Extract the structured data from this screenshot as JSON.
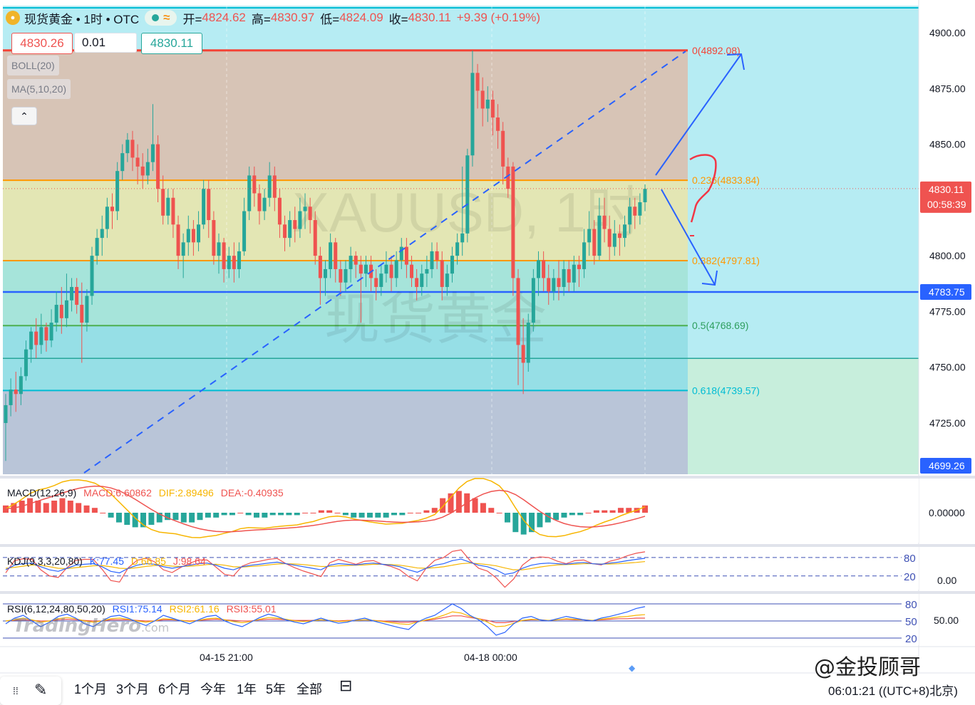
{
  "header": {
    "symbol_name": "现货黄金 • 1时 • OTC",
    "open_label": "开=",
    "open": "4824.62",
    "high_label": "高=",
    "high": "4830.97",
    "low_label": "低=",
    "low": "4824.09",
    "close_label": "收=",
    "close": "4830.11",
    "change": "+9.39 (+0.19%)"
  },
  "quote": {
    "bid": "4830.26",
    "spread": "0.01",
    "ask": "4830.11"
  },
  "indicators": {
    "boll": "BOLL(20)",
    "ma": "MA(5,10,20)"
  },
  "watermark": {
    "line1": "XAUUSD, 1时",
    "line2": "现货黄金"
  },
  "price_axis": {
    "ticks": [
      "4900.00",
      "4875.00",
      "4850.00",
      "4800.00",
      "4775.00",
      "4750.00",
      "4725.00"
    ],
    "current_price": "4830.11",
    "countdown": "00:58:39",
    "line_label": "4783.75",
    "low_label": "4699.26"
  },
  "fib": {
    "l0": "0(4892.08)",
    "l236": "0.236(4833.84)",
    "l382": "0.382(4797.81)",
    "l5": "0.5(4768.69)",
    "l618": "0.618(4739.57)"
  },
  "macd": {
    "title": "MACD(12,26,9)",
    "macd": "MACD:6.60862",
    "dif": "DIF:2.89496",
    "dea": "DEA:-0.40935",
    "axis": "0.00000"
  },
  "kdj": {
    "title": "KDJ(9,3,3,20,80)",
    "k": "K:77.45",
    "d": "D:66.85",
    "j": "J:98.64",
    "upper": "80",
    "lower": "20",
    "axis": "0.00"
  },
  "rsi": {
    "title": "RSI(6,12,24,80,50,20)",
    "rsi1": "RSI1:75.14",
    "rsi2": "RSI2:61.16",
    "rsi3": "RSI3:55.01",
    "l80": "80",
    "l50": "50",
    "l20": "20",
    "axis": "50.00"
  },
  "time_axis": [
    "04-15 21:00",
    "04-18 00:00"
  ],
  "timeframes": [
    "1个月",
    "3个月",
    "6个月",
    "今年",
    "1年",
    "5年",
    "全部"
  ],
  "clock": "06:01:21 ((UTC+8)北京)",
  "brand": "@金投顾哥",
  "logo": {
    "main": "TradingHero",
    "suffix": ".com"
  },
  "colors": {
    "up": "#26a69a",
    "down": "#ef5350",
    "fib0": "#f44336",
    "fib236": "#ff9800",
    "fib382": "#ff9800",
    "fib5": "#4caf50",
    "fib618": "#00bcd4",
    "trend": "#2962ff",
    "panel": "#b2ebf2"
  },
  "chart_data": {
    "type": "candlestick",
    "symbol": "XAUUSD",
    "interval": "1H",
    "ylim": [
      4699.26,
      4910
    ],
    "candles": [
      [
        4725,
        4733,
        4708,
        4738
      ],
      [
        4733,
        4740,
        4728,
        4745
      ],
      [
        4740,
        4738,
        4730,
        4748
      ],
      [
        4738,
        4746,
        4733,
        4750
      ],
      [
        4746,
        4758,
        4744,
        4762
      ],
      [
        4758,
        4766,
        4752,
        4768
      ],
      [
        4766,
        4760,
        4754,
        4772
      ],
      [
        4760,
        4768,
        4756,
        4774
      ],
      [
        4768,
        4762,
        4757,
        4770
      ],
      [
        4762,
        4770,
        4759,
        4776
      ],
      [
        4770,
        4778,
        4766,
        4784
      ],
      [
        4778,
        4772,
        4765,
        4786
      ],
      [
        4772,
        4780,
        4768,
        4792
      ],
      [
        4780,
        4786,
        4775,
        4790
      ],
      [
        4786,
        4778,
        4774,
        4790
      ],
      [
        4778,
        4770,
        4752,
        4788
      ],
      [
        4770,
        4782,
        4766,
        4785
      ],
      [
        4782,
        4800,
        4778,
        4804
      ],
      [
        4800,
        4808,
        4796,
        4812
      ],
      [
        4808,
        4812,
        4800,
        4818
      ],
      [
        4812,
        4822,
        4808,
        4826
      ],
      [
        4822,
        4820,
        4812,
        4828
      ],
      [
        4820,
        4838,
        4816,
        4842
      ],
      [
        4838,
        4846,
        4834,
        4850
      ],
      [
        4846,
        4852,
        4842,
        4855
      ],
      [
        4852,
        4844,
        4838,
        4856
      ],
      [
        4844,
        4840,
        4832,
        4850
      ],
      [
        4840,
        4836,
        4830,
        4846
      ],
      [
        4836,
        4842,
        4832,
        4848
      ],
      [
        4842,
        4850,
        4838,
        4868
      ],
      [
        4850,
        4830,
        4824,
        4854
      ],
      [
        4830,
        4818,
        4814,
        4836
      ],
      [
        4818,
        4826,
        4814,
        4830
      ],
      [
        4826,
        4814,
        4808,
        4830
      ],
      [
        4814,
        4800,
        4794,
        4818
      ],
      [
        4800,
        4806,
        4790,
        4810
      ],
      [
        4806,
        4812,
        4800,
        4818
      ],
      [
        4812,
        4806,
        4800,
        4816
      ],
      [
        4806,
        4814,
        4802,
        4820
      ],
      [
        4814,
        4830,
        4812,
        4834
      ],
      [
        4830,
        4816,
        4808,
        4834
      ],
      [
        4816,
        4800,
        4796,
        4820
      ],
      [
        4800,
        4806,
        4792,
        4810
      ],
      [
        4806,
        4794,
        4788,
        4808
      ],
      [
        4794,
        4800,
        4790,
        4804
      ],
      [
        4800,
        4794,
        4788,
        4806
      ],
      [
        4794,
        4802,
        4790,
        4806
      ],
      [
        4802,
        4820,
        4800,
        4826
      ],
      [
        4820,
        4836,
        4816,
        4840
      ],
      [
        4836,
        4828,
        4822,
        4840
      ],
      [
        4828,
        4820,
        4814,
        4832
      ],
      [
        4820,
        4826,
        4816,
        4830
      ],
      [
        4826,
        4836,
        4822,
        4842
      ],
      [
        4836,
        4826,
        4820,
        4840
      ],
      [
        4826,
        4814,
        4808,
        4830
      ],
      [
        4814,
        4808,
        4802,
        4818
      ],
      [
        4808,
        4816,
        4804,
        4820
      ],
      [
        4816,
        4812,
        4806,
        4822
      ],
      [
        4812,
        4820,
        4808,
        4826
      ],
      [
        4820,
        4822,
        4812,
        4828
      ],
      [
        4822,
        4816,
        4810,
        4826
      ],
      [
        4816,
        4800,
        4796,
        4820
      ],
      [
        4800,
        4790,
        4778,
        4804
      ],
      [
        4790,
        4794,
        4782,
        4798
      ],
      [
        4794,
        4806,
        4790,
        4810
      ],
      [
        4806,
        4794,
        4788,
        4808
      ],
      [
        4794,
        4788,
        4782,
        4798
      ],
      [
        4788,
        4794,
        4784,
        4798
      ],
      [
        4794,
        4800,
        4788,
        4804
      ],
      [
        4800,
        4796,
        4790,
        4802
      ],
      [
        4796,
        4792,
        4770,
        4800
      ],
      [
        4792,
        4796,
        4786,
        4800
      ],
      [
        4796,
        4790,
        4784,
        4800
      ],
      [
        4790,
        4786,
        4780,
        4794
      ],
      [
        4786,
        4792,
        4782,
        4796
      ],
      [
        4792,
        4796,
        4788,
        4802
      ],
      [
        4796,
        4790,
        4784,
        4800
      ],
      [
        4790,
        4798,
        4786,
        4802
      ],
      [
        4798,
        4804,
        4794,
        4808
      ],
      [
        4804,
        4796,
        4790,
        4808
      ],
      [
        4796,
        4790,
        4786,
        4800
      ],
      [
        4790,
        4786,
        4780,
        4794
      ],
      [
        4786,
        4792,
        4782,
        4796
      ],
      [
        4792,
        4794,
        4786,
        4800
      ],
      [
        4794,
        4802,
        4790,
        4806
      ],
      [
        4802,
        4798,
        4794,
        4806
      ],
      [
        4798,
        4786,
        4780,
        4802
      ],
      [
        4786,
        4792,
        4782,
        4796
      ],
      [
        4792,
        4800,
        4788,
        4804
      ],
      [
        4800,
        4806,
        4796,
        4810
      ],
      [
        4806,
        4810,
        4800,
        4840
      ],
      [
        4810,
        4845,
        4806,
        4848
      ],
      [
        4845,
        4882,
        4840,
        4892
      ],
      [
        4882,
        4874,
        4866,
        4886
      ],
      [
        4874,
        4866,
        4858,
        4880
      ],
      [
        4866,
        4870,
        4860,
        4876
      ],
      [
        4870,
        4862,
        4854,
        4874
      ],
      [
        4862,
        4856,
        4848,
        4868
      ],
      [
        4856,
        4840,
        4832,
        4860
      ],
      [
        4840,
        4830,
        4826,
        4844
      ],
      [
        4840,
        4790,
        4782,
        4842
      ],
      [
        4790,
        4760,
        4742,
        4794
      ],
      [
        4760,
        4752,
        4738,
        4772
      ],
      [
        4752,
        4770,
        4748,
        4774
      ],
      [
        4770,
        4790,
        4766,
        4794
      ],
      [
        4790,
        4798,
        4782,
        4802
      ],
      [
        4798,
        4790,
        4784,
        4802
      ],
      [
        4790,
        4784,
        4778,
        4796
      ],
      [
        4784,
        4790,
        4780,
        4794
      ],
      [
        4790,
        4786,
        4780,
        4798
      ],
      [
        4786,
        4794,
        4782,
        4798
      ],
      [
        4794,
        4788,
        4784,
        4798
      ],
      [
        4788,
        4796,
        4784,
        4800
      ],
      [
        4796,
        4794,
        4786,
        4800
      ],
      [
        4794,
        4806,
        4790,
        4812
      ],
      [
        4806,
        4812,
        4800,
        4820
      ],
      [
        4812,
        4800,
        4796,
        4816
      ],
      [
        4800,
        4818,
        4798,
        4826
      ],
      [
        4818,
        4812,
        4806,
        4826
      ],
      [
        4812,
        4804,
        4798,
        4818
      ],
      [
        4804,
        4810,
        4800,
        4816
      ],
      [
        4810,
        4808,
        4800,
        4814
      ],
      [
        4808,
        4814,
        4804,
        4818
      ],
      [
        4814,
        4822,
        4810,
        4826
      ],
      [
        4822,
        4818,
        4812,
        4826
      ],
      [
        4818,
        4824,
        4814,
        4828
      ],
      [
        4824,
        4830,
        4820,
        4832
      ]
    ],
    "fib_levels": [
      {
        "ratio": 0,
        "price": 4892.08
      },
      {
        "ratio": 0.236,
        "price": 4833.84
      },
      {
        "ratio": 0.382,
        "price": 4797.81
      },
      {
        "ratio": 0.5,
        "price": 4768.69
      },
      {
        "ratio": 0.618,
        "price": 4739.57
      }
    ],
    "horizontal_line": 4783.75,
    "extra_level": 4754,
    "macd_hist": [
      3,
      4,
      5,
      6,
      5,
      4,
      5,
      6,
      5,
      4,
      3,
      2,
      0,
      -2,
      -4,
      -5,
      -6,
      -6,
      -5,
      -4,
      -3,
      -3,
      -4,
      -4,
      -3,
      -2,
      -2,
      -1,
      -1,
      0,
      -1,
      -2,
      -2,
      -1,
      -1,
      -1,
      -1,
      0,
      0,
      1,
      1,
      0,
      -1,
      -2,
      -2,
      -2,
      -2,
      -2,
      -1,
      -1,
      0,
      0,
      1,
      2,
      6,
      8,
      9,
      8,
      6,
      4,
      2,
      0,
      -4,
      -8,
      -9,
      -8,
      -6,
      -4,
      -3,
      -2,
      -1,
      -1,
      0,
      1,
      1,
      1,
      2,
      2,
      2,
      3
    ],
    "kdj": {
      "k": [
        40,
        55,
        60,
        62,
        50,
        40,
        35,
        45,
        55,
        58,
        60,
        50,
        35,
        30,
        45,
        55,
        60,
        58,
        50,
        45,
        50,
        55,
        60,
        62,
        55,
        45,
        40,
        50,
        55,
        58,
        62,
        65,
        60,
        55,
        50,
        45,
        40,
        55,
        60,
        58,
        56,
        60,
        62,
        58,
        55,
        50,
        40,
        32,
        45,
        55,
        60,
        70,
        75,
        65,
        55,
        50,
        40,
        25,
        30,
        45,
        55,
        60,
        62,
        60,
        58,
        62,
        64,
        60,
        58,
        62,
        65,
        70,
        74,
        77.45
      ],
      "d": [
        45,
        48,
        52,
        56,
        55,
        50,
        45,
        44,
        47,
        50,
        53,
        54,
        50,
        45,
        44,
        47,
        51,
        54,
        55,
        52,
        51,
        52,
        54,
        57,
        58,
        55,
        50,
        49,
        51,
        53,
        56,
        59,
        60,
        59,
        57,
        54,
        51,
        51,
        53,
        54,
        55,
        56,
        58,
        58,
        57,
        55,
        51,
        46,
        45,
        47,
        50,
        55,
        60,
        62,
        60,
        57,
        53,
        46,
        40,
        40,
        44,
        49,
        53,
        56,
        57,
        58,
        60,
        60,
        59,
        59,
        60,
        62,
        64,
        66.85
      ],
      "j": [
        30,
        70,
        76,
        74,
        40,
        20,
        15,
        47,
        71,
        74,
        74,
        42,
        5,
        0,
        47,
        71,
        78,
        66,
        40,
        31,
        48,
        61,
        72,
        72,
        49,
        25,
        20,
        52,
        63,
        68,
        74,
        77,
        60,
        47,
        36,
        27,
        18,
        63,
        74,
        66,
        58,
        68,
        70,
        58,
        51,
        40,
        18,
        4,
        45,
        71,
        80,
        100,
        105,
        71,
        45,
        36,
        14,
        -17,
        10,
        55,
        77,
        82,
        80,
        68,
        60,
        70,
        72,
        60,
        56,
        68,
        75,
        86,
        94,
        98.64
      ]
    },
    "rsi": {
      "rsi1": [
        45,
        55,
        60,
        50,
        40,
        48,
        58,
        62,
        55,
        45,
        40,
        50,
        58,
        60,
        55,
        48,
        42,
        50,
        60,
        55,
        50,
        45,
        52,
        58,
        60,
        50,
        44,
        40,
        48,
        56,
        62,
        58,
        52,
        48,
        45,
        50,
        55,
        50,
        46,
        48,
        52,
        55,
        50,
        46,
        42,
        38,
        35,
        48,
        55,
        60,
        70,
        80,
        72,
        60,
        52,
        40,
        25,
        30,
        45,
        55,
        58,
        52,
        50,
        54,
        58,
        55,
        52,
        50,
        55,
        58,
        62,
        66,
        72,
        75.14
      ],
      "rsi2": [
        50,
        52,
        55,
        52,
        48,
        50,
        54,
        56,
        54,
        50,
        48,
        50,
        54,
        55,
        53,
        50,
        48,
        50,
        54,
        53,
        51,
        49,
        51,
        54,
        55,
        52,
        49,
        47,
        49,
        53,
        56,
        55,
        53,
        50,
        49,
        50,
        52,
        51,
        49,
        50,
        51,
        52,
        51,
        49,
        47,
        45,
        44,
        48,
        52,
        55,
        60,
        66,
        64,
        58,
        54,
        48,
        40,
        41,
        46,
        51,
        53,
        52,
        51,
        52,
        54,
        53,
        52,
        51,
        53,
        55,
        57,
        58,
        60,
        61.16
      ],
      "rsi3": [
        50,
        51,
        52,
        51,
        50,
        50,
        52,
        53,
        52,
        51,
        50,
        50,
        52,
        52,
        52,
        51,
        50,
        50,
        52,
        52,
        51,
        50,
        51,
        52,
        53,
        52,
        51,
        50,
        50,
        52,
        53,
        53,
        52,
        51,
        51,
        51,
        52,
        51,
        50,
        51,
        51,
        52,
        51,
        50,
        49,
        48,
        48,
        49,
        51,
        53,
        56,
        59,
        59,
        56,
        54,
        51,
        47,
        47,
        49,
        51,
        52,
        52,
        51,
        52,
        53,
        52,
        52,
        51,
        52,
        53,
        54,
        54,
        55,
        55.01
      ]
    }
  }
}
